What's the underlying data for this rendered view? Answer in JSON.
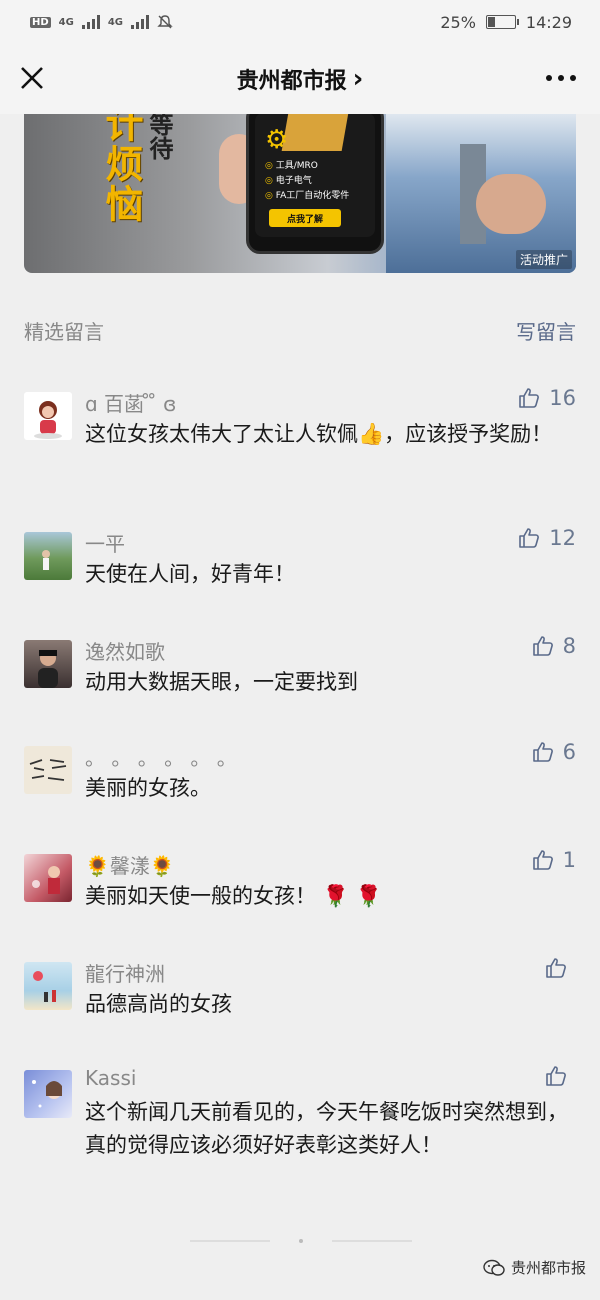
{
  "status_bar": {
    "network_left": "HD",
    "net1": "4G",
    "net2": "4G",
    "battery_percent_text": "25%",
    "battery_level": 0.25,
    "time": "14:29"
  },
  "nav": {
    "title": "贵州都市报",
    "chevron": "›",
    "close_icon": "close-icon",
    "more_icon": "more-icon"
  },
  "ad": {
    "left_text": "计烦恼",
    "left_text_top": "没",
    "left_text2": "等待",
    "items": [
      "工具/MRO",
      "电子电气",
      "FA工厂自动化零件"
    ],
    "button": "点我了解",
    "tag": "活动推广"
  },
  "section": {
    "title": "精选留言",
    "write": "写留言"
  },
  "comments": [
    {
      "name": "ɑ 百菡 ̊ ̊ ɞ",
      "likes": "16",
      "text": "这位女孩太伟大了太让人钦佩👍，应该授予奖励！"
    },
    {
      "name": "一平",
      "likes": "12",
      "text": "天使在人间，好青年！"
    },
    {
      "name": "逸然如歌",
      "likes": "8",
      "text": "动用大数据天眼，一定要找到"
    },
    {
      "name": "。 。 。 。 。 。",
      "likes": "6",
      "text": "美丽的女孩。"
    },
    {
      "name": "🌻馨漾🌻",
      "likes": "1",
      "text": "美丽如天使一般的女孩！ 🌹 🌹"
    },
    {
      "name": "龍行神洲",
      "likes": "",
      "text": "品德高尚的女孩"
    },
    {
      "name": "Kassi",
      "likes": "",
      "text": "这个新闻几天前看见的，今天午餐吃饭时突然想到，真的觉得应该必须好好表彰这类好人！"
    }
  ],
  "watermark": "贵州都市报",
  "colors": {
    "accent": "#5a6a8a",
    "background": "#efefef",
    "ad_yellow": "#f4c400"
  }
}
